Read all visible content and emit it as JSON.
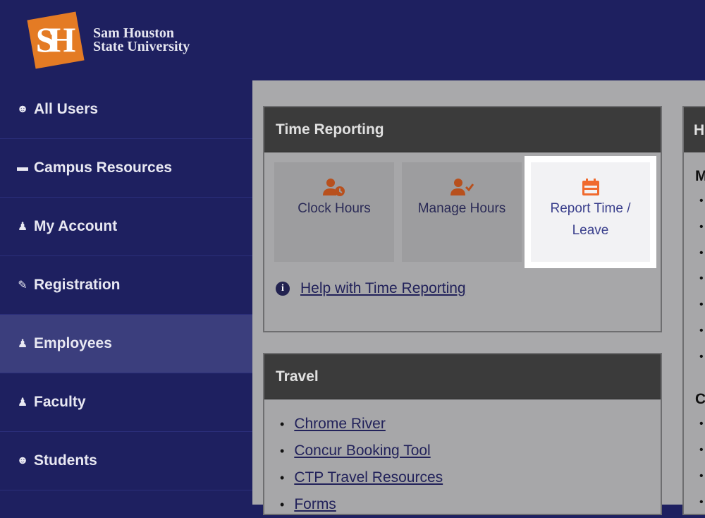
{
  "brand": {
    "logo_letters": "SH",
    "name_line1": "Sam Houston",
    "name_line2": "State University",
    "accent": "#e47b24"
  },
  "sidebar": {
    "items": [
      {
        "label": "All Users",
        "icon": "users-icon"
      },
      {
        "label": "Campus Resources",
        "icon": "folder-icon"
      },
      {
        "label": "My Account",
        "icon": "user-icon"
      },
      {
        "label": "Registration",
        "icon": "edit-icon"
      },
      {
        "label": "Employees",
        "icon": "user-tie-icon",
        "active": true
      },
      {
        "label": "Faculty",
        "icon": "user-tie-icon"
      },
      {
        "label": "Students",
        "icon": "users-icon"
      }
    ]
  },
  "time_reporting": {
    "title": "Time Reporting",
    "tiles": [
      {
        "label": "Clock Hours",
        "icon": "user-clock-icon"
      },
      {
        "label": "Manage Hours",
        "icon": "user-check-icon"
      },
      {
        "label_line1": "Report Time /",
        "label_line2": "Leave",
        "icon": "calendar-icon",
        "highlighted": true
      }
    ],
    "help_link": "Help with Time Reporting"
  },
  "travel": {
    "title": "Travel",
    "links": [
      "Chrome River",
      "Concur Booking Tool",
      "CTP Travel Resources",
      "Forms"
    ]
  },
  "right_panel": {
    "title_fragment": "H",
    "sub1": "M",
    "sub2": "C"
  }
}
